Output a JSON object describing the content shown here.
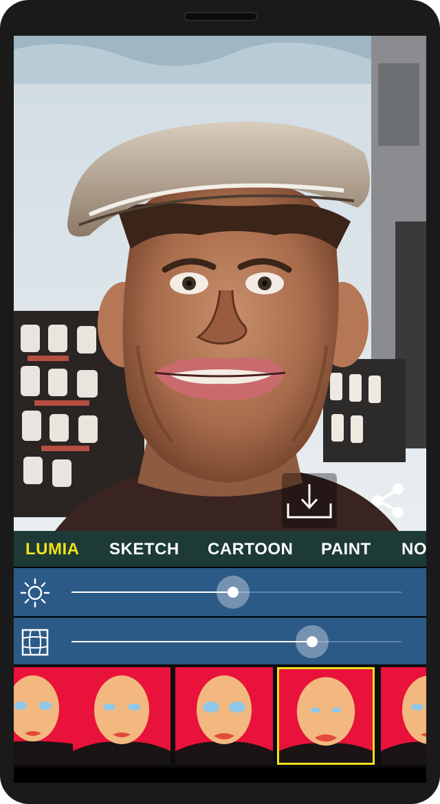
{
  "tabs": [
    {
      "label": "LUMIA",
      "active": true
    },
    {
      "label": "SKETCH",
      "active": false
    },
    {
      "label": "CARTOON",
      "active": false
    },
    {
      "label": "PAINT",
      "active": false
    },
    {
      "label": "NO",
      "active": false
    }
  ],
  "sliders": [
    {
      "name": "brightness",
      "icon": "sun-icon",
      "value_fraction": 0.49
    },
    {
      "name": "distortion",
      "icon": "warp-grid-icon",
      "value_fraction": 0.73
    }
  ],
  "actions": {
    "download_icon": "download-icon",
    "share_icon": "share-icon"
  },
  "presets": {
    "count_visible": 5,
    "selected_index": 3
  },
  "colors": {
    "accent": "#f4e21a",
    "tab_bar": "#1d3a36",
    "slider_bg": "#2b5a87",
    "preset_bg": "#e8123a"
  }
}
